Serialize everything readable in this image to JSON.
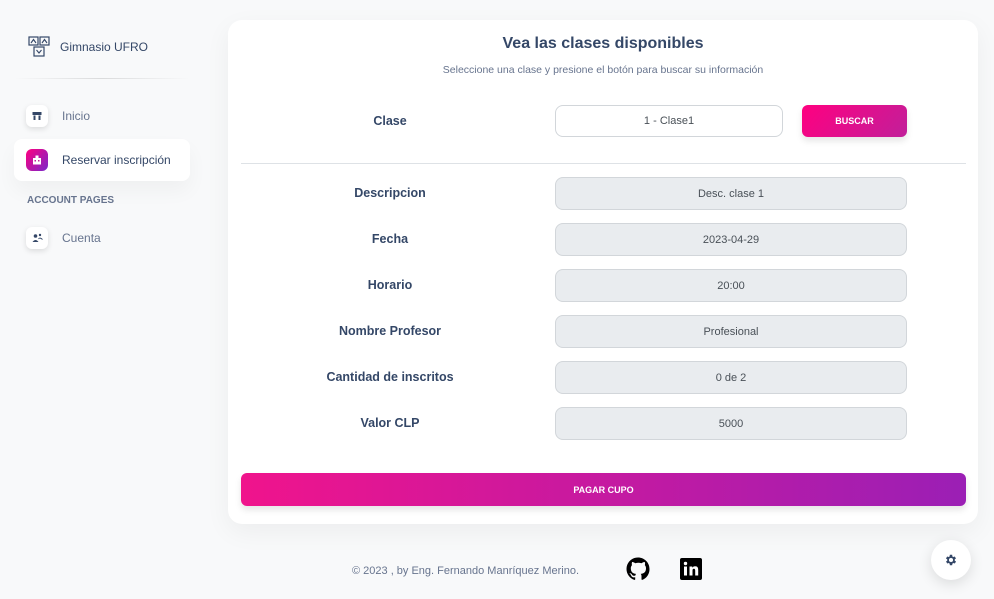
{
  "brand": {
    "name": "Gimnasio UFRO",
    "icon": "gym-logo-icon"
  },
  "sidebar": {
    "items": [
      {
        "label": "Inicio",
        "icon": "shop-icon",
        "active": false
      },
      {
        "label": "Reservar inscripción",
        "icon": "office-icon",
        "active": true
      }
    ],
    "section_heading": "ACCOUNT PAGES",
    "account_items": [
      {
        "label": "Cuenta",
        "icon": "users-icon",
        "active": false
      }
    ]
  },
  "main": {
    "title": "Vea las clases disponibles",
    "subtitle": "Seleccione una clase y presione el botón para buscar su información",
    "clase_label": "Clase",
    "clase_value": "1 - Clase1",
    "buscar_label": "BUSCAR",
    "fields": [
      {
        "label": "Descripcion",
        "value": "Desc. clase 1"
      },
      {
        "label": "Fecha",
        "value": "2023-04-29"
      },
      {
        "label": "Horario",
        "value": "20:00"
      },
      {
        "label": "Nombre Profesor",
        "value": "Profesional"
      },
      {
        "label": "Cantidad de inscritos",
        "value": "0 de 2"
      },
      {
        "label": "Valor CLP",
        "value": "5000"
      }
    ],
    "pagar_label": "PAGAR CUPO"
  },
  "footer": {
    "text": "© 2023 , by Eng. Fernando Manríquez Merino.",
    "icons": [
      "github-icon",
      "linkedin-icon"
    ]
  },
  "colors": {
    "accent_start": "#ff0080",
    "accent_end": "#7928ca",
    "text": "#344767",
    "muted": "#67748e"
  }
}
